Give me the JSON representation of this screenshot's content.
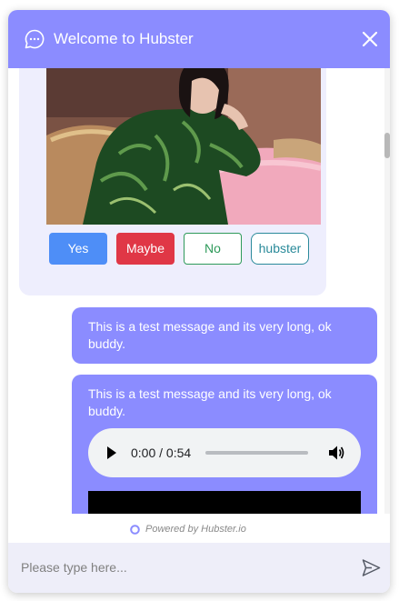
{
  "header": {
    "title": "Welcome to Hubster",
    "icon": "chat-bubble-icon",
    "close_icon": "close-icon",
    "background": "#8b8cff"
  },
  "incoming_message": {
    "image": "woman-in-green-dress-photo",
    "quick_replies": [
      {
        "label": "Yes",
        "color": "#4e8ef7"
      },
      {
        "label": "Maybe",
        "color": "#e03746"
      },
      {
        "label": "No",
        "color": "#2e9a5a"
      },
      {
        "label": "hubster",
        "color": "#2a8a9a"
      }
    ]
  },
  "outgoing_messages": [
    {
      "text": "This is a test message and its very long, ok buddy."
    },
    {
      "text": "This is a test message and its very long, ok buddy.",
      "audio": {
        "time": "0:00 / 0:54",
        "progress": 0
      }
    }
  ],
  "footer": {
    "powered_by": "Powered by Hubster.io"
  },
  "composer": {
    "placeholder": "Please type here...",
    "value": "",
    "send_icon": "send-icon"
  }
}
